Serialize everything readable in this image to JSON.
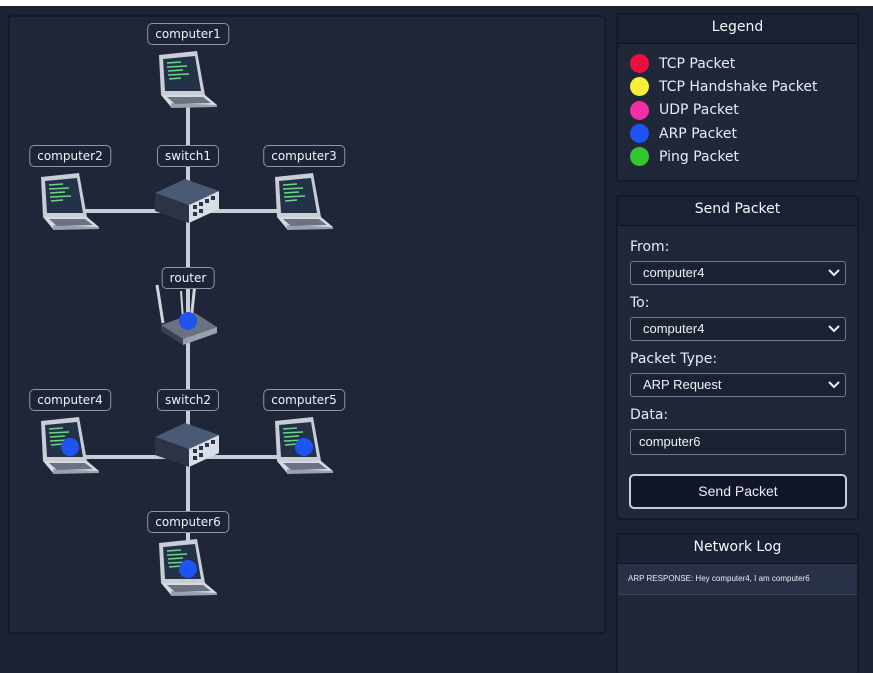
{
  "network": {
    "nodes": [
      {
        "id": "computer1",
        "label": "computer1",
        "type": "computer"
      },
      {
        "id": "computer2",
        "label": "computer2",
        "type": "computer"
      },
      {
        "id": "switch1",
        "label": "switch1",
        "type": "switch"
      },
      {
        "id": "computer3",
        "label": "computer3",
        "type": "computer"
      },
      {
        "id": "router",
        "label": "router",
        "type": "router"
      },
      {
        "id": "computer4",
        "label": "computer4",
        "type": "computer"
      },
      {
        "id": "switch2",
        "label": "switch2",
        "type": "switch"
      },
      {
        "id": "computer5",
        "label": "computer5",
        "type": "computer"
      },
      {
        "id": "computer6",
        "label": "computer6",
        "type": "computer"
      }
    ],
    "packets_shown_at": [
      "router",
      "computer4",
      "computer5",
      "computer6"
    ],
    "packet_color": "#1e54f1"
  },
  "legend": {
    "title": "Legend",
    "items": [
      {
        "label": "TCP Packet",
        "color": "#e8113d"
      },
      {
        "label": "TCP Handshake Packet",
        "color": "#f6f03a"
      },
      {
        "label": "UDP Packet",
        "color": "#ef2fa6"
      },
      {
        "label": "ARP Packet",
        "color": "#1e54f1"
      },
      {
        "label": "Ping Packet",
        "color": "#33c632"
      }
    ]
  },
  "send_packet": {
    "title": "Send Packet",
    "from_label": "From:",
    "from_value": "computer4",
    "to_label": "To:",
    "to_value": "computer4",
    "type_label": "Packet Type:",
    "type_value": "ARP Request",
    "data_label": "Data:",
    "data_value": "computer6",
    "button_label": "Send Packet"
  },
  "network_log": {
    "title": "Network Log",
    "entries": [
      "ARP RESPONSE: Hey computer4, I am computer6"
    ]
  }
}
